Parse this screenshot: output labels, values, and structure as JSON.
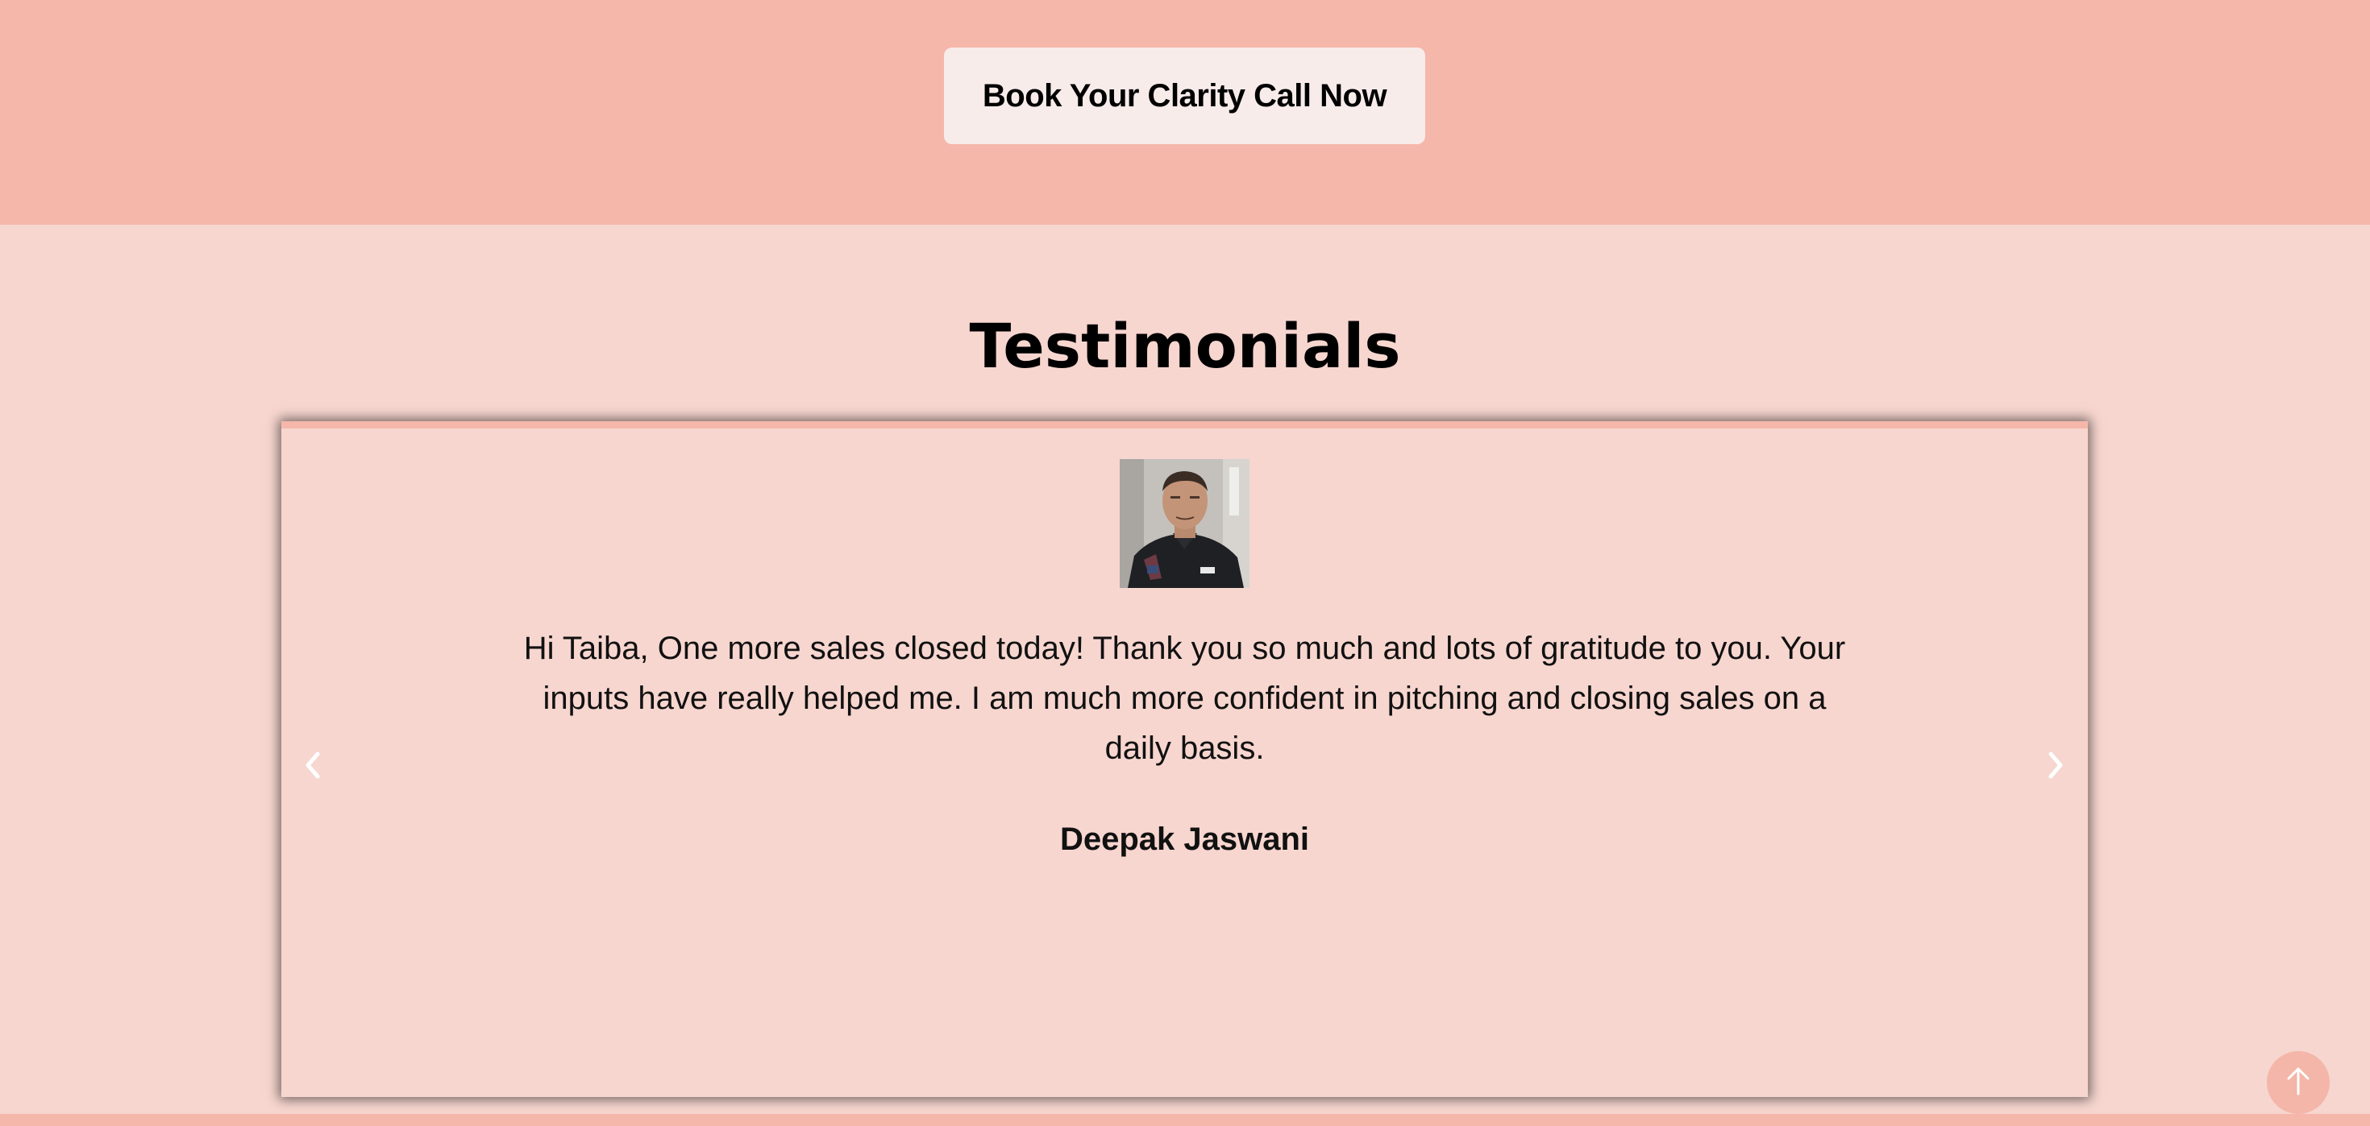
{
  "cta": {
    "button_label": "Book Your Clarity Call Now"
  },
  "testimonials": {
    "title": "Testimonials",
    "current": {
      "quote": "Hi Taiba, One more sales closed today! Thank you so much and lots of gratitude to you. Your inputs have really helped me. I am much more confident in pitching and closing sales on a daily basis.",
      "author": "Deepak Jaswani"
    },
    "prev_icon": "chevron-left-icon",
    "next_icon": "chevron-right-icon"
  },
  "scroll_top": {
    "icon": "arrow-up-icon"
  },
  "colors": {
    "band": "#f5b7aa",
    "section_bg": "#f7d6cf",
    "button_bg": "#f7ece9"
  }
}
